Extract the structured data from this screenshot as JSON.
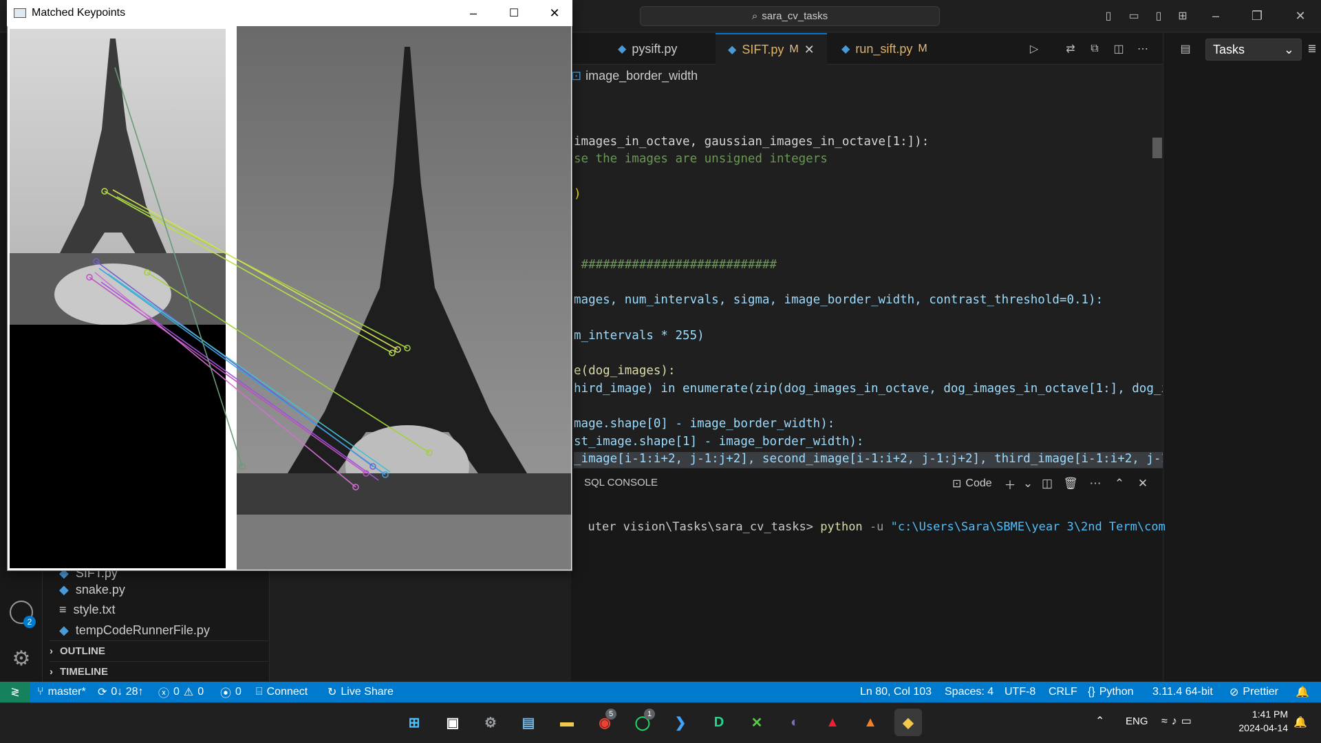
{
  "vscode": {
    "command_center": "sara_cv_tasks",
    "tabs": [
      {
        "name": "pysift.py",
        "modified": ""
      },
      {
        "name": "SIFT.py",
        "modified": "M"
      },
      {
        "name": "run_sift.py",
        "modified": "M"
      }
    ],
    "breadcrumb": "image_border_width",
    "aux_panel": {
      "select_value": "Tasks"
    },
    "code_lines": [
      {
        "text": "images_in_octave, gaussian_images_in_octave[1:]):"
      },
      {
        "text": "se the images are unsigned integers"
      },
      {
        "text": ")"
      },
      {
        "text": " ###########################"
      },
      {
        "text": "mages, num_intervals, sigma, image_border_width, contrast_threshold=0.1):"
      },
      {
        "text": "m_intervals * 255)"
      },
      {
        "text": "e(dog_images):"
      },
      {
        "text": "hird_image) in enumerate(zip(dog_images_in_octave, dog_images_in_octave[1:], dog_im"
      },
      {
        "text": "mage.shape[0] - image_border_width):"
      },
      {
        "text": "st_image.shape[1] - image_border_width):"
      },
      {
        "text": "_image[i-1:i+2, j-1:j+2], second_image[i-1:i+2, j-1:j+2], third_image[i-1:i+2, j-1:"
      }
    ],
    "panel": {
      "tab": "SQL CONSOLE",
      "terminal_profile": "Code",
      "terminal_path": "uter vision\\Tasks\\sara_cv_tasks>",
      "terminal_cmd": "python",
      "terminal_flag": "-u",
      "terminal_arg": "\"c:\\Users\\Sara\\SBME\\year 3\\2nd Term\\com"
    },
    "explorer": {
      "files": [
        {
          "name": "SIFT.py",
          "icon": "python-file-icon"
        },
        {
          "name": "snake.py",
          "icon": "python-file-icon"
        },
        {
          "name": "style.txt",
          "icon": "text-file-icon"
        },
        {
          "name": "tempCodeRunnerFile.py",
          "icon": "python-file-icon"
        }
      ],
      "sections": [
        "OUTLINE",
        "TIMELINE"
      ]
    },
    "accounts_badge": "2",
    "statusbar": {
      "branch": "master*",
      "sync": "0↓ 28↑",
      "errors": "0",
      "warnings": "0",
      "ports": "0",
      "connect": "Connect",
      "live_share": "Live Share",
      "position": "Ln 80, Col 103",
      "spaces": "Spaces: 4",
      "encoding": "UTF-8",
      "eol": "CRLF",
      "language": "Python",
      "interpreter": "3.11.4 64-bit",
      "formatter": "Prettier"
    },
    "accent": "#007acc"
  },
  "opencv_window": {
    "title": "Matched Keypoints"
  },
  "taskbar": {
    "apps": [
      "Start",
      "Microsoft Store",
      "Settings",
      "Terminal",
      "File Explorer",
      "Chrome",
      "WhatsApp",
      "VS Code",
      "DataGrip",
      "Tool",
      "Eclipse",
      "Acrobat",
      "VLC",
      "Python"
    ],
    "chrome_badge": "5",
    "whatsapp_badge": "1",
    "language": "ENG",
    "time": "1:41 PM",
    "date": "2024-04-14"
  }
}
